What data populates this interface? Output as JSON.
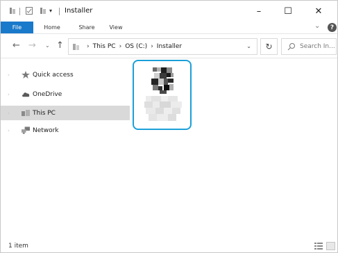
{
  "window": {
    "title": "Installer",
    "qa_dropdown": "▾",
    "controls": {
      "minimize": "–",
      "maximize": "☐",
      "close": "✕"
    }
  },
  "ribbon": {
    "tabs": [
      "File",
      "Home",
      "Share",
      "View"
    ],
    "collapse": "⌄",
    "help": "?"
  },
  "navigation": {
    "back": "←",
    "forward": "→",
    "recent": "⌄",
    "up": "↑",
    "breadcrumb": [
      "This PC",
      "OS (C:)",
      "Installer"
    ],
    "separator": "›",
    "dropdown": "⌄",
    "refresh": "↻",
    "search_placeholder": "Search In..."
  },
  "navpane": {
    "items": [
      {
        "label": "Quick access",
        "icon": "star-icon"
      },
      {
        "label": "OneDrive",
        "icon": "cloud-icon"
      },
      {
        "label": "This PC",
        "icon": "computer-icon",
        "selected": true
      },
      {
        "label": "Network",
        "icon": "network-icon"
      }
    ],
    "expand_glyph": "›"
  },
  "files": [
    {
      "icon": "installer-qr-icon",
      "name_blurred": true,
      "selected": true
    }
  ],
  "status": {
    "item_count": "1 item"
  },
  "colors": {
    "accent": "#1979ca",
    "selection_border": "#1aa0d8",
    "nav_selected": "#d9d9d9"
  }
}
